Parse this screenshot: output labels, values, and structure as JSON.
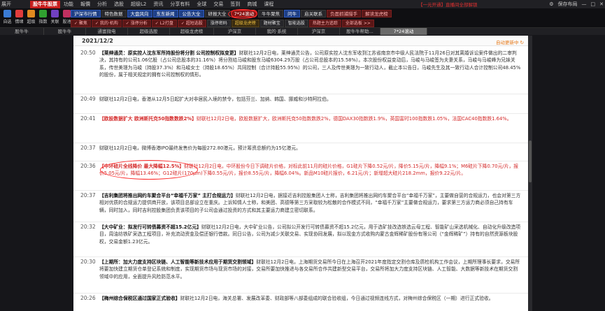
{
  "menubar": {
    "items": [
      "展开",
      "功能",
      "報價",
      "分析",
      "选股",
      "超级L2",
      "资讯",
      "分享有料",
      "全球",
      "交易",
      "签到",
      "商城",
      "课程"
    ],
    "logo": "股牛牛股票",
    "promo": "【一元开通】直播间全部解锁",
    "right": [
      "⚙",
      "保存布局",
      "—",
      "□",
      "✕"
    ]
  },
  "toolbar": {
    "icons": [
      {
        "label": "自选",
        "color": "#3a7bd5",
        "name": "favorites-icon"
      },
      {
        "label": "情绪",
        "color": "#e03c3c",
        "name": "sentiment-icon"
      },
      {
        "label": "超级",
        "color": "#e08a20",
        "name": "super-icon"
      },
      {
        "label": "指数",
        "color": "#30a030",
        "name": "index-icon"
      },
      {
        "label": "关联",
        "color": "#7040c0",
        "name": "link-icon"
      },
      {
        "label": "股池",
        "color": "#c03060",
        "name": "stock-pool-icon"
      }
    ],
    "row1": [
      {
        "label": "沪深市行情",
        "style": "blue"
      },
      {
        "label": "特色数据",
        "style": "dark"
      },
      {
        "label": "大盘风向",
        "style": "blue"
      },
      {
        "label": "东东新闻",
        "style": "blue"
      },
      {
        "label": "公告大全",
        "style": "blue"
      },
      {
        "label": "研报大全",
        "style": "dark"
      },
      {
        "label": "7*24滚动",
        "style": "hl"
      },
      {
        "label": "牛牛聚焦",
        "style": "dark"
      },
      {
        "label": "问牛",
        "style": "blue"
      },
      {
        "label": "启关联系",
        "style": "dark"
      },
      {
        "label": "负面抓捕猎手",
        "style": "red"
      },
      {
        "label": "解读龙虎榜",
        "style": "red"
      }
    ],
    "row2": [
      {
        "label": "✓ 聚焦",
        "style": "red"
      },
      {
        "label": "✓ 我的·机构",
        "style": "red"
      },
      {
        "label": "✓ 涨停分析",
        "style": "red"
      },
      {
        "label": "✓ L2打盘",
        "style": "red"
      },
      {
        "label": "✓ 超短选股",
        "style": "red"
      },
      {
        "label": "涨停密码",
        "style": "dark"
      },
      {
        "label": "超级龙虎榜",
        "style": "yel"
      },
      {
        "label": "题材聚宝",
        "style": "dark"
      },
      {
        "label": "智能选股",
        "style": "dark"
      },
      {
        "label": "热题主力追踪",
        "style": "red"
      },
      {
        "label": "全部选板 >>",
        "style": "red"
      }
    ]
  },
  "tabs": [
    {
      "label": "股牛牛",
      "active": false
    },
    {
      "label": "股牛牛",
      "active": false
    },
    {
      "label": "通富微电",
      "active": false
    },
    {
      "label": "超级选股",
      "active": false
    },
    {
      "label": "超级龙虎榜",
      "active": false
    },
    {
      "label": "沪深京",
      "active": false
    },
    {
      "label": "我的·系统",
      "active": false
    },
    {
      "label": "沪深京",
      "active": false
    },
    {
      "label": "股牛牛帮助...",
      "active": false
    },
    {
      "label": "7*24滚动",
      "active": true
    }
  ],
  "panel": {
    "date": "2021/12/2",
    "auto_refresh": "自动更新中",
    "news": [
      {
        "time": "20:50",
        "red": false,
        "title": "【莱绅通灵：原实控人沈东军所持股份将分割 公司控制权拟变更】",
        "text": "财联社12月2日电，莱绅通灵公告，公司原实控人沈东军收到江苏省南京市中级人民法院于11月26日对其离婚诉讼案件做出的二审判决，其持有的公司1.06亿股（占公司总股本的31.16%）将分割给马峻和股东马峻6304.29万股（占公司总股本的15.58%）。本次股份权益变动后，马峻与马峻签为夫妻关系，马峻与马峻峰为兄妹关系，传世美璟为马峻（持股37.3%）和马峻女士（持股18.65%）共同控制（合计持股55.95%）的公司，三人及传世美璟为一致行动人，截止本公告日，马峻先生及其一致行动人合计控制公司48.45%的股份，属于相关规定的拥有公司控制权的情形。"
      },
      {
        "time": "20:49",
        "red": false,
        "title": "",
        "text": "财联社12月2日电，香港从12月5日起扩大对非居民入境的禁令，包括芬兰、加纳、韩国、挪威和沙特阿拉伯。"
      },
      {
        "time": "20:41",
        "red": true,
        "title": "【欧股数据扩大 欧洲斯托克50指数数跌2%】",
        "text": "财联社12月2日电，欧股数据扩大，欧洲斯托克50指数数跌2%，德国DAX30指数跌1.9%，英国富时100指数跌1.05%，法国CAC40指数跌1.64%。"
      },
      {
        "time": "20:37",
        "red": false,
        "title": "",
        "text": "财联社12月2日电，微博香港IPO最终发售价为每股272.80港元，预计筹资总额约为15亿港元。"
      },
      {
        "time": "20:36",
        "red": true,
        "title": "【中环硅片全线降价 最大降幅12.5%】",
        "text": "财联社12月2日电，中环股份今日下调硅片价格，对标此前11月的硅片价格，G1硅片下降0.52元/片，降价5.15元/片，降幅9.1%；M6硅片下降0.70元/片，报价5.05元/片，降幅13.46%；G12硅片(170μm)下降0.55元/片，报价8.55元/片，降幅6.04%。新品M10硅片报价，6.21元/片；新增超大硅片218.2mm，报价9.22元/片。"
      },
      {
        "time": "20:37",
        "red": false,
        "title": "【吉利集团将推出网约车聚合平台“幸福千万家” 主打合规运力】",
        "text": "财联社12月2日电，据接近吉利控股集团人士称，吉利集团将推出网约车聚合平台“幸福千万家”，主要做自营的合规运力，也会对第三方相对优质的合规运力提供商开放，该项目总部设立在重庆。上诉知情人士称，和美团、高德等第三方采取较为松散的合作模式不同，“幸福千万家”主要做合规运力，要求第三方运力商必须自己持有车辆，同时加入，同时吉利控股集团负责该项目的子公司会通过投资的方式和其主要运力商建立密切联系。"
      },
      {
        "time": "20:32",
        "red": false,
        "title": "【大中矿业：拟发行可转债募资不超15.2亿元】",
        "text": "财联社12月2日电，大中矿业公告，公司拟公开发行可转债募资不超15.2亿元，用于选矿技改选铁选云母工程、智能矿山采选机械化、自动化升级改造项目，周油坊铁矿采选工程项目，补充流动资金及偿还银行借款。同日公告，公司为减少关联交易、实现协同发展，拟以现金方式收购内蒙古金辉稀矿股份有限公司（“金辉稀矿”）持有的自然资源板块股权，交易金额1.23亿元。"
      },
      {
        "time": "20:30",
        "red": false,
        "title": "【上期所：加大力度支持区块链、人工智能等新技术应用于期货交割领域】",
        "text": "财联社12月2日电，上海期货交易所今日在上海召开2021年度指定交割仓库及质检机构工作会议，上期所理事长要求，交易所将要加快建立期货仓单登记系统和制度，实现期货市场与现货市场的对接，交易所要加快推进与各交易所合作共建新型交易平台，交易所将加大力度支持区块链、人工智能、大数据等新技术在期货交割领域中的应用，全面提升风险防范水平。"
      },
      {
        "time": "20:26",
        "red": false,
        "title": "【梅州综合保税区通过国家正式验收】",
        "text": "财联社12月2日电，海关总署、发展改革委、财政部等八部委组成的联合验收组，今日通过视频连线方式，对梅州综合保税区（一期）进行正式验收。"
      }
    ]
  },
  "colors": {
    "accent_red": "#d42a2a",
    "highlight_circle": "#ff2a2a",
    "auto_refresh": "#e67817",
    "panel_bg": "#ffffff",
    "app_bg": "#16161a"
  }
}
